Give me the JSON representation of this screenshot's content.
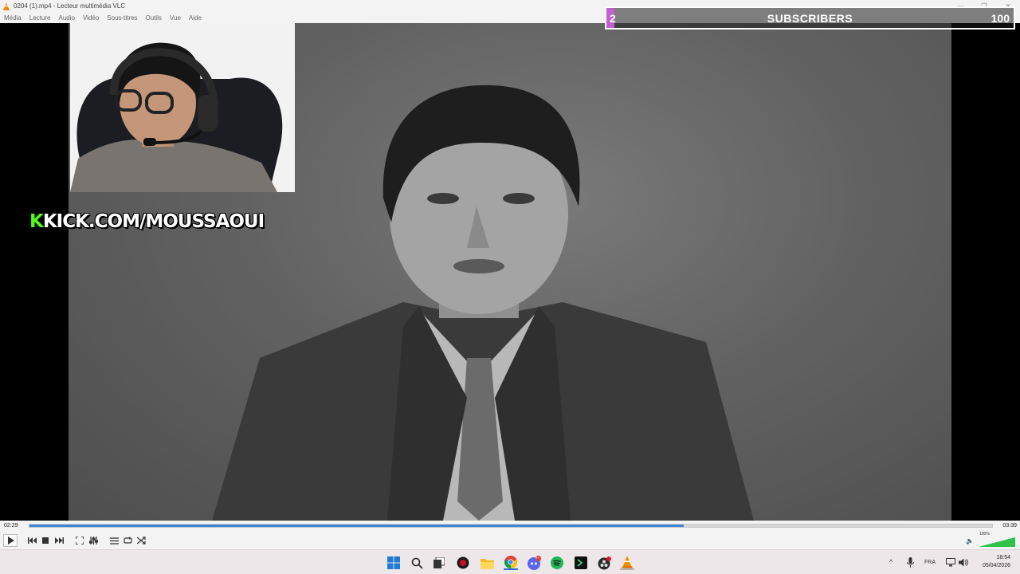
{
  "window": {
    "title": "0204 (1).mp4 - Lecteur multimédia VLC",
    "controls": [
      "—",
      "❐",
      "✕"
    ]
  },
  "menu": {
    "items": [
      "Média",
      "Lecture",
      "Audio",
      "Vidéo",
      "Sous-titres",
      "Outils",
      "Vue",
      "Aide"
    ]
  },
  "overlay": {
    "kick_k": "K",
    "kick_text": "KICK.COM/MOUSSAOUI",
    "goal": {
      "current": "2",
      "label": "SUBSCRIBERS",
      "target": "100",
      "progress_fraction": 0.02,
      "fill_color": "#c25fd1"
    }
  },
  "player": {
    "time_current": "02:29",
    "time_total": "03:39",
    "progress_fraction": 0.68,
    "seek_color": "#3c86d6",
    "volume_label": "100%",
    "volume_fraction": 1.0,
    "buttons": [
      "play-icon",
      "previous-icon",
      "stop-icon",
      "next-icon",
      "fullscreen-icon",
      "extended-settings-icon",
      "playlist-icon",
      "loop-icon",
      "shuffle-icon"
    ]
  },
  "taskbar": {
    "icons": [
      "windows-start-icon",
      "search-icon",
      "task-view-icon",
      "app-red-icon",
      "file-explorer-icon",
      "chrome-icon",
      "discord-icon",
      "spotify-icon",
      "terminal-icon",
      "obs-icon",
      "vlc-icon"
    ],
    "discord_badge": "9+",
    "language": "FRA",
    "time": "18:54",
    "date": "05/04/2026"
  }
}
